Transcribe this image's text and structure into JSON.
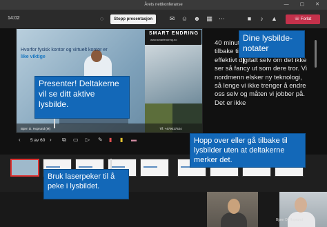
{
  "window": {
    "title": "Årets nettkonferanse",
    "controls": [
      "—",
      "▢",
      "✕"
    ]
  },
  "toolbar": {
    "time": "14:02",
    "stop_label": "Stopp presentasjon",
    "leave_label": "Forlat",
    "icons": [
      "shield-icon",
      "chat-icon",
      "people-icon",
      "reactions-icon",
      "rooms-icon",
      "more-icon",
      "camera-icon",
      "mic-icon",
      "share-icon"
    ]
  },
  "slide": {
    "heading": "Hvorfor fysisk kontor og virtuelt kontor er",
    "heading_emph": "like viktige",
    "logo_title": "SMART ENDRING",
    "logo_url": "www.smartendring.no",
    "footer_left": "Bjørn D. Hoprund (M)",
    "footer_right": "Tlf: +479017524"
  },
  "notes": {
    "text": "40 minutter ... Dere disponerer tilbake til å arbeide svært effektivt digitalt selv om det ikke ser så fancy ut som dere tror. Vi nordmenn elsker ny teknologi, så lenge vi ikke trenger å endre oss selv og måten vi jobber på. Det er ikke"
  },
  "controls": {
    "slide_counter": "5 av 60",
    "icons": [
      "prev-icon",
      "next-icon",
      "grid-icon",
      "pointer-icon",
      "laser-icon",
      "pen-icon",
      "highlighter-icon",
      "eraser-icon"
    ]
  },
  "callouts": {
    "presenter": "Presenter! Deltakerne vil se ditt aktive lysbilde.",
    "notes": "Dine lysbilde-notater",
    "skip": "Hopp over eller gå tilbake til lysbilder uten at deltakerne merker det.",
    "laser": "Bruk laserpeker til å peke i lysbildet."
  },
  "participants": {
    "cam2_name": "Bjørn D. Hoprund"
  },
  "colors": {
    "accent": "#1368b8",
    "leave": "#c4314b",
    "active_border": "#d33"
  }
}
